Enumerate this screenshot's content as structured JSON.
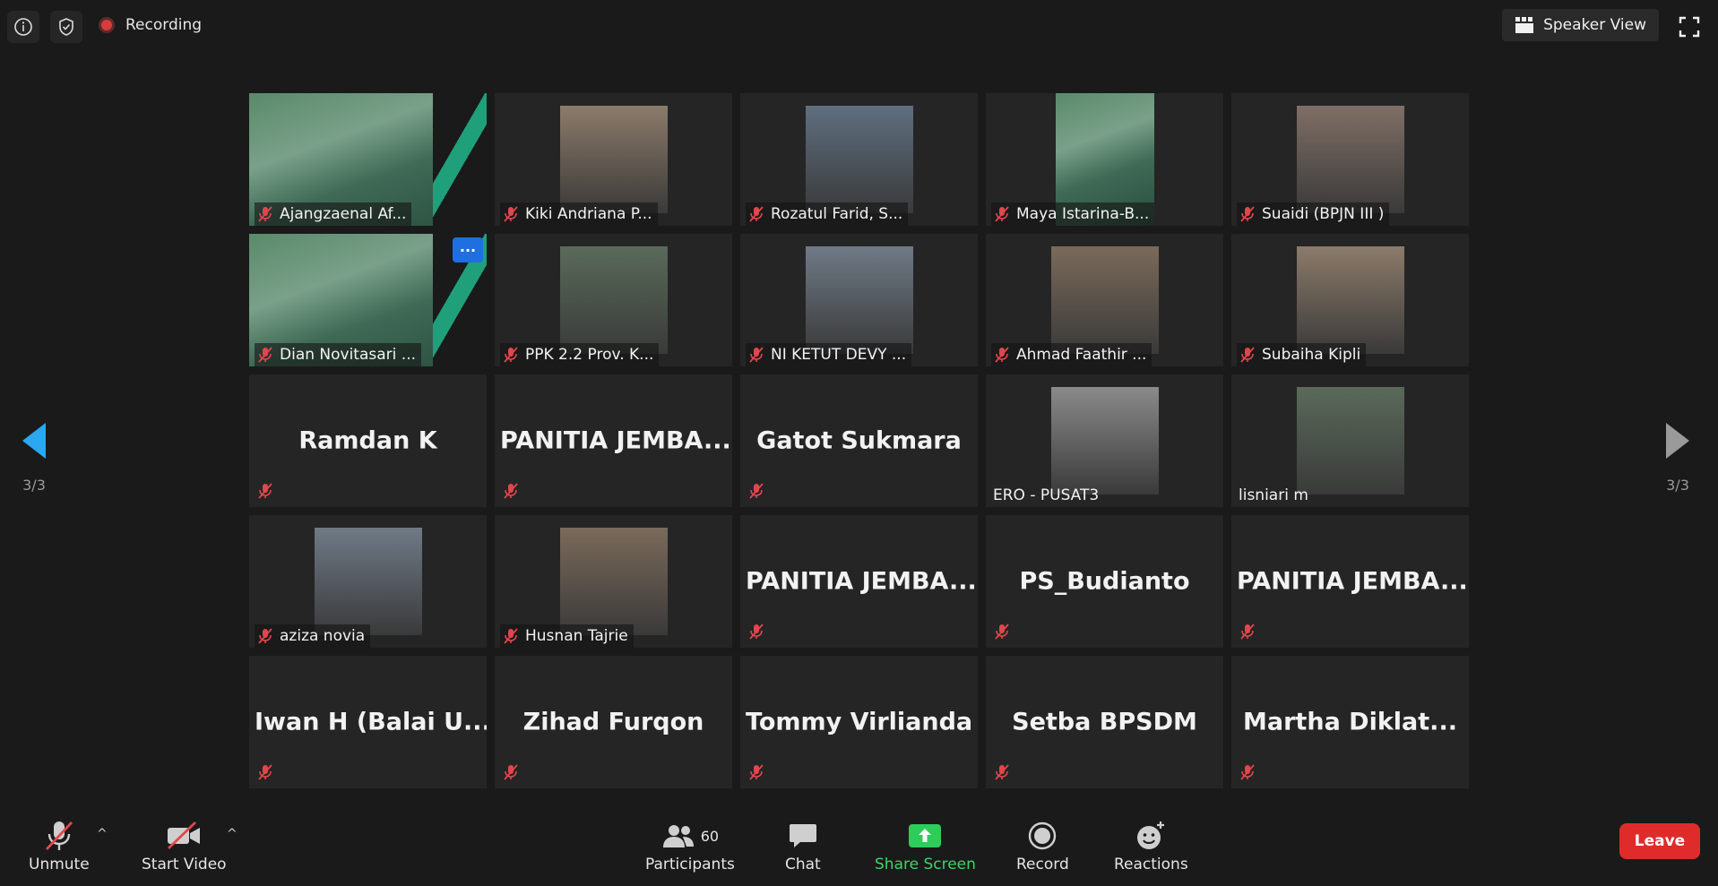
{
  "header": {
    "recording_label": "Recording",
    "view_label": "Speaker View"
  },
  "navigation": {
    "left_page": "3/3",
    "right_page": "3/3"
  },
  "tiles": [
    {
      "name": "Ajangzaenal Af...",
      "type": "slide"
    },
    {
      "name": "Kiki Andriana P...",
      "type": "video"
    },
    {
      "name": "Rozatul Farid, S...",
      "type": "video"
    },
    {
      "name": "Maya Istarina-B...",
      "type": "slide-small"
    },
    {
      "name": "Suaidi (BPJN III )",
      "type": "video"
    },
    {
      "name": "Dian Novitasari ...",
      "type": "slide",
      "more": "···"
    },
    {
      "name": "PPK 2.2 Prov. K...",
      "type": "video"
    },
    {
      "name": "NI KETUT DEVY ...",
      "type": "video"
    },
    {
      "name": "Ahmad Faathir ...",
      "type": "video"
    },
    {
      "name": "Subaiha Kipli",
      "type": "video"
    },
    {
      "name": "Ramdan K",
      "type": "name"
    },
    {
      "name": "PANITIA JEMBA...",
      "type": "name"
    },
    {
      "name": "Gatot Sukmara",
      "type": "name"
    },
    {
      "name": "ERO - PUSAT3",
      "type": "video-nomic"
    },
    {
      "name": "lisniari m",
      "type": "video-nomic"
    },
    {
      "name": "aziza novia",
      "type": "video"
    },
    {
      "name": "Husnan Tajrie",
      "type": "video"
    },
    {
      "name": "PANITIA JEMBA...",
      "type": "name"
    },
    {
      "name": "PS_Budianto",
      "type": "name"
    },
    {
      "name": "PANITIA JEMBA...",
      "type": "name"
    },
    {
      "name": "Iwan H (Balai U...",
      "type": "name"
    },
    {
      "name": "Zihad Furqon",
      "type": "name"
    },
    {
      "name": "Tommy Virlianda",
      "type": "name"
    },
    {
      "name": "Setba BPSDM",
      "type": "name"
    },
    {
      "name": "Martha Diklat...",
      "type": "name"
    }
  ],
  "toolbar": {
    "unmute": "Unmute",
    "start_video": "Start Video",
    "participants": "Participants",
    "participants_count": "60",
    "chat": "Chat",
    "share_screen": "Share Screen",
    "record": "Record",
    "reactions": "Reactions",
    "leave": "Leave"
  },
  "colors": {
    "accent_blue": "#2aa8f0",
    "share_green": "#3fd46a",
    "leave_red": "#e02b2b",
    "mic_off_red": "#e0474c"
  }
}
